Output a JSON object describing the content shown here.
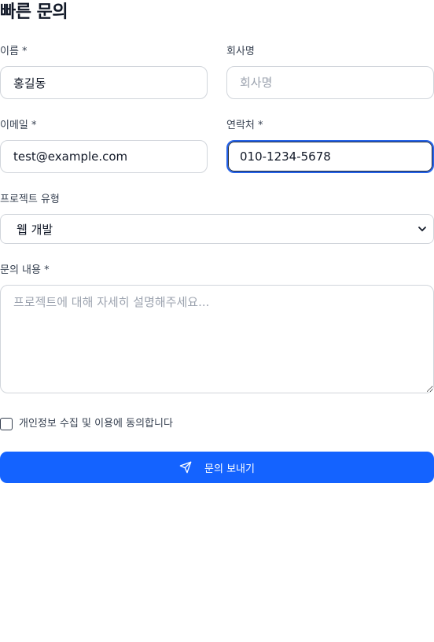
{
  "form": {
    "title": "빠른 문의",
    "name": {
      "label": "이름 *",
      "value": "홍길동",
      "placeholder": ""
    },
    "company": {
      "label": "회사명",
      "value": "",
      "placeholder": "회사명"
    },
    "email": {
      "label": "이메일 *",
      "value": "test@example.com",
      "placeholder": ""
    },
    "phone": {
      "label": "연락처 *",
      "value": "010-1234-5678",
      "placeholder": ""
    },
    "project_type": {
      "label": "프로젝트 유형",
      "selected": "웹 개발",
      "icon": "chevron-down-icon"
    },
    "message": {
      "label": "문의 내용 *",
      "value": "",
      "placeholder": "프로젝트에 대해 자세히 설명해주세요..."
    },
    "consent": {
      "label": "개인정보 수집 및 이용에 동의합니다",
      "checked": false
    },
    "submit": {
      "label": "문의 보내기",
      "icon": "send-icon"
    }
  },
  "colors": {
    "accent": "#1463ff",
    "focus_ring": "#2563eb",
    "border": "#d1d5db",
    "placeholder": "#9ca3af"
  }
}
